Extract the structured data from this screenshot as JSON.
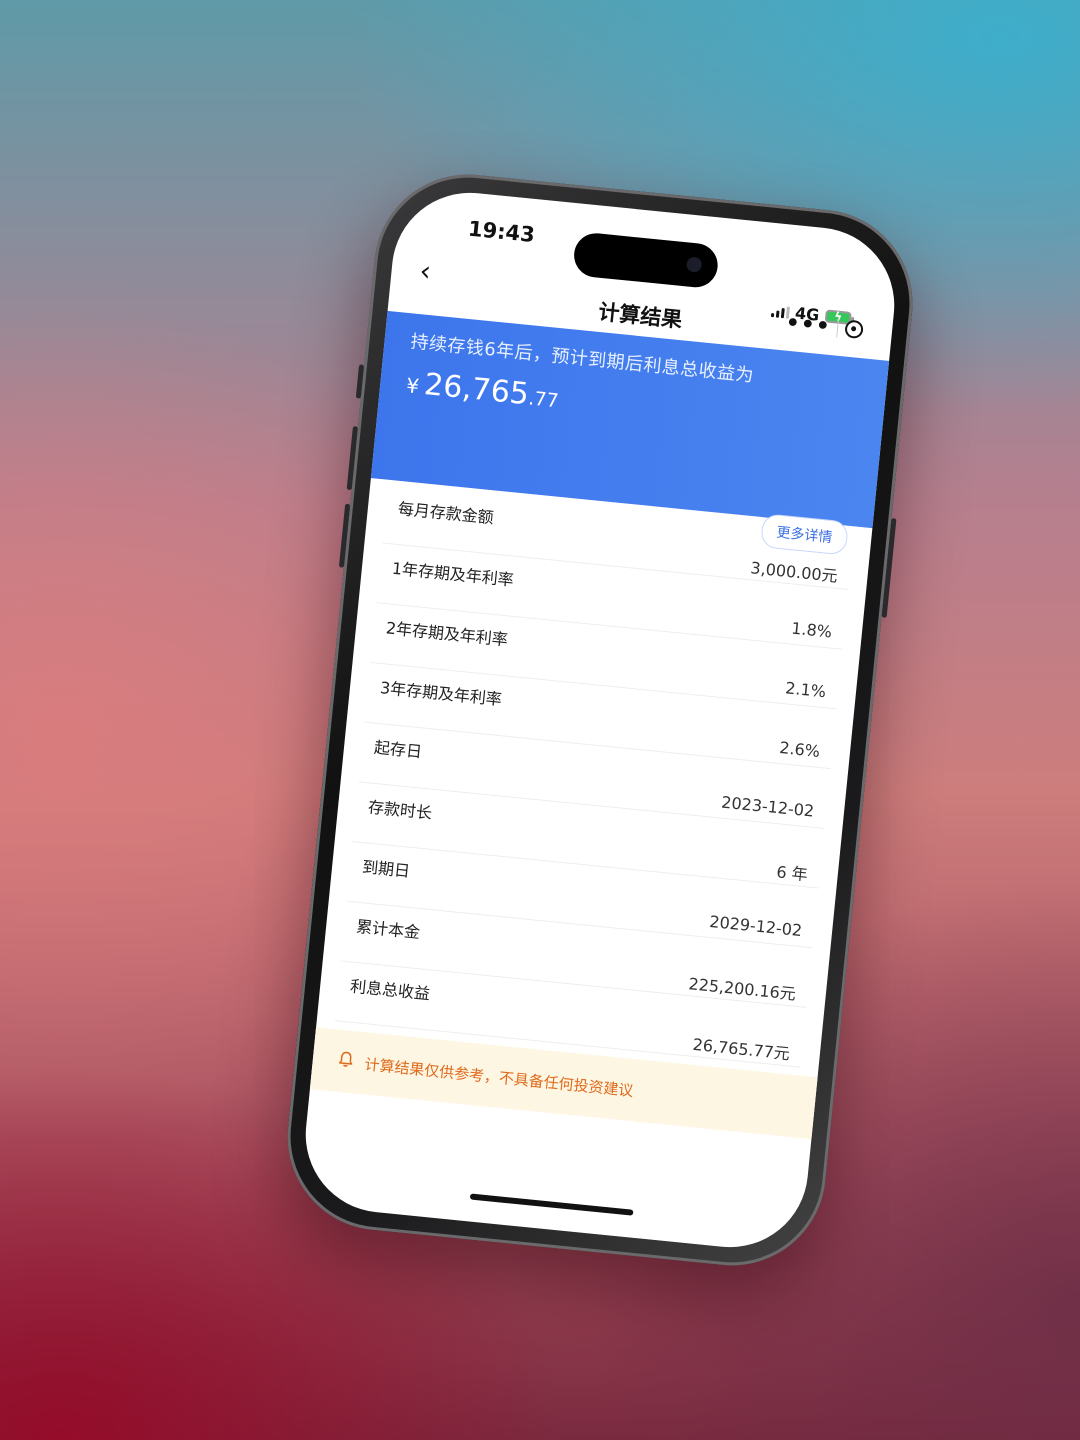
{
  "status_bar": {
    "time": "19:43",
    "network": "4G"
  },
  "nav": {
    "back_glyph": "‹",
    "title": "计算结果",
    "more_glyph": "•••"
  },
  "banner": {
    "text": "持续存钱6年后，预计到期后利息总收益为",
    "currency": "¥",
    "amount_int": "26,765",
    "amount_dec": ".77"
  },
  "detail_button": "更多详情",
  "rows": [
    {
      "label": "每月存款金额",
      "value": "3,000.00元"
    },
    {
      "label": "1年存期及年利率",
      "value": "1.8%"
    },
    {
      "label": "2年存期及年利率",
      "value": "2.1%"
    },
    {
      "label": "3年存期及年利率",
      "value": "2.6%"
    },
    {
      "label": "起存日",
      "value": "2023-12-02"
    },
    {
      "label": "存款时长",
      "value": "6 年"
    },
    {
      "label": "到期日",
      "value": "2029-12-02"
    },
    {
      "label": "累计本金",
      "value": "225,200.16元"
    },
    {
      "label": "利息总收益",
      "value": "26,765.77元"
    }
  ],
  "tip": {
    "text": "计算结果仅供参考，不具备任何投资建议"
  },
  "icons": [
    "back-chevron-icon",
    "more-dots-icon",
    "target-close-icon",
    "bell-icon",
    "signal-icon",
    "battery-charging-icon"
  ],
  "colors": {
    "banner_blue": "#3c74ec",
    "tip_orange": "#e06a1c",
    "tip_bg": "#fdf6e3"
  }
}
